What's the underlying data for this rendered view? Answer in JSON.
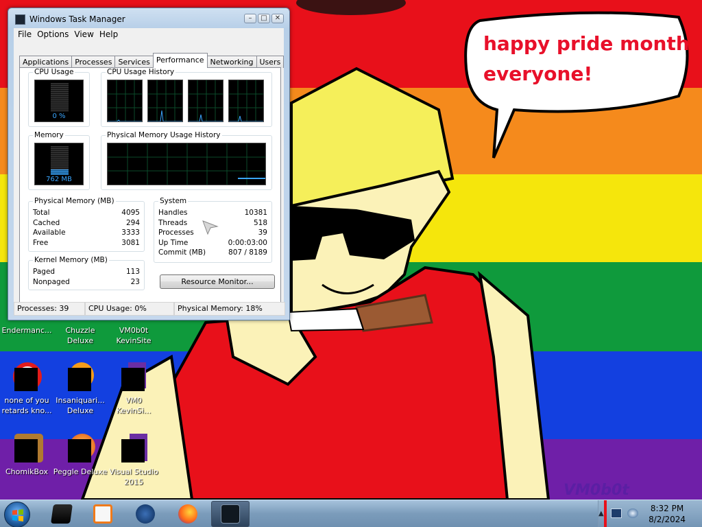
{
  "wallpaper": {
    "stripe_colors": [
      "#e8101a",
      "#f58a1c",
      "#f5e60c",
      "#0f9a3c",
      "#1340e0",
      "#6f1fa8"
    ],
    "speech_bubble": [
      "happy pride month",
      "everyone!"
    ],
    "signature": "VM0b0t"
  },
  "desktop_icons": [
    {
      "label": "Endermanc...",
      "icon": "endermanch-icon"
    },
    {
      "label": "Chuzzle\nDeluxe",
      "icon": "chuzzle-icon"
    },
    {
      "label": "VM0b0t\nKevinSite",
      "icon": "vm-kevinsite-icon"
    },
    {
      "label": "none of you\nretards kno...",
      "icon": "opera-icon"
    },
    {
      "label": "Insaniquari...\nDeluxe",
      "icon": "insaniquarium-icon"
    },
    {
      "label": "VM0\nKevinSi...",
      "icon": "vm-kevinsite-2-icon"
    },
    {
      "label": "ChomikBox",
      "icon": "chomikbox-icon"
    },
    {
      "label": "Peggle Deluxe",
      "icon": "peggle-icon"
    },
    {
      "label": "Visual Studio\n2015",
      "icon": "visual-studio-icon"
    }
  ],
  "taskmgr": {
    "title": "Windows Task Manager",
    "menu": [
      "File",
      "Options",
      "View",
      "Help"
    ],
    "tabs": [
      "Applications",
      "Processes",
      "Services",
      "Performance",
      "Networking",
      "Users"
    ],
    "active_tab": "Performance",
    "cpu_usage": {
      "title": "CPU Usage",
      "value": "0 %",
      "percent": 0
    },
    "cpu_history": {
      "title": "CPU Usage History",
      "cores": 4
    },
    "memory": {
      "title": "Memory",
      "value": "762 MB",
      "fraction": 0.18
    },
    "memory_history": {
      "title": "Physical Memory Usage History"
    },
    "physical_memory": {
      "title": "Physical Memory (MB)",
      "rows": [
        {
          "label": "Total",
          "value": "4095"
        },
        {
          "label": "Cached",
          "value": "294"
        },
        {
          "label": "Available",
          "value": "3333"
        },
        {
          "label": "Free",
          "value": "3081"
        }
      ]
    },
    "system": {
      "title": "System",
      "rows": [
        {
          "label": "Handles",
          "value": "10381"
        },
        {
          "label": "Threads",
          "value": "518"
        },
        {
          "label": "Processes",
          "value": "39"
        },
        {
          "label": "Up Time",
          "value": "0:00:03:00"
        },
        {
          "label": "Commit (MB)",
          "value": "807 / 8189"
        }
      ]
    },
    "kernel_memory": {
      "title": "Kernel Memory (MB)",
      "rows": [
        {
          "label": "Paged",
          "value": "113"
        },
        {
          "label": "Nonpaged",
          "value": "23"
        }
      ]
    },
    "resource_monitor_button": "Resource Monitor...",
    "status": {
      "processes": "Processes: 39",
      "cpu": "CPU Usage: 0%",
      "memory": "Physical Memory: 18%"
    }
  },
  "taskbar": {
    "items": [
      "file-explorer-icon",
      "media-player-icon",
      "thunderbird-icon",
      "firefox-icon",
      "task-manager-icon"
    ],
    "active_item": "task-manager-icon",
    "clock": {
      "time": "8:32 PM",
      "date": "8/2/2024"
    }
  }
}
